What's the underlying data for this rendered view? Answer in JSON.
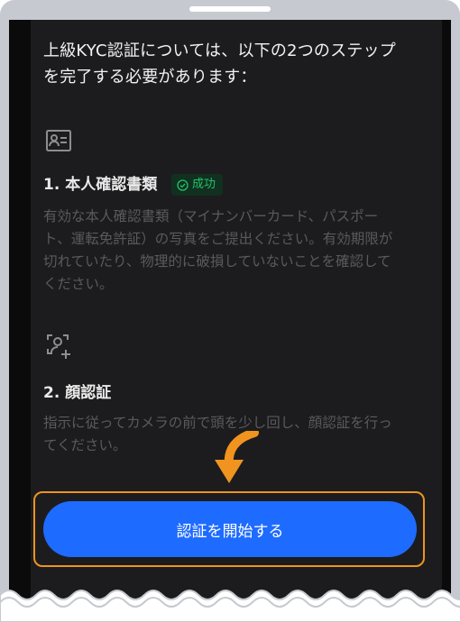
{
  "intro": {
    "line1": "上級KYC認証については、以下の2つのステップ",
    "line2": "を完了する必要があります："
  },
  "steps": [
    {
      "icon": "id-card-icon",
      "title": "1. 本人確認書類",
      "badge": "成功",
      "badge_color": "#21c26b",
      "desc_lines": [
        "有効な本人確認書類（マイナンバーカード、パスポー",
        "ト、運転免許証）の写真をご提出ください。有効期限が",
        "切れていたり、物理的に破損していないことを確認して",
        "ください。"
      ]
    },
    {
      "icon": "face-scan-icon",
      "title": "2. 顔認証",
      "desc_lines": [
        "指示に従ってカメラの前で頭を少し回し、顔認証を行っ",
        "てください。"
      ]
    }
  ],
  "cta": {
    "label": "認証を開始する",
    "color": "#1e6bff",
    "highlight_color": "#f0931f"
  }
}
